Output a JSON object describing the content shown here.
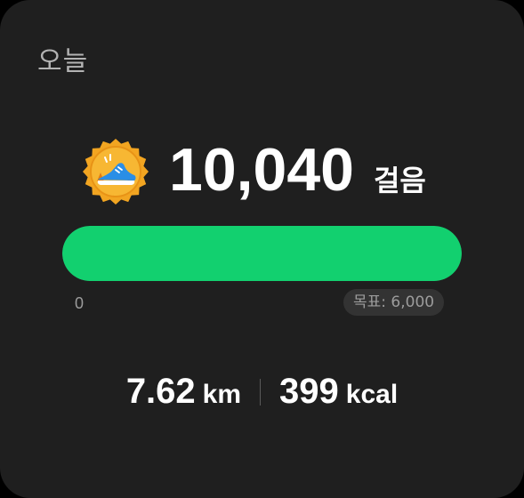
{
  "header": {
    "title": "오늘"
  },
  "steps": {
    "badge_icon": "running-shoe-badge-icon",
    "value": "10,040",
    "unit": "걸음"
  },
  "progress": {
    "min_label": "0",
    "goal_label": "목표: 6,000",
    "fraction": 1.0,
    "fill_color": "#12d06f"
  },
  "stats": {
    "distance_value": "7.62",
    "distance_unit": "km",
    "calories_value": "399",
    "calories_unit": "kcal"
  },
  "colors": {
    "card_background": "#1f1f1f",
    "badge_gold": "#f2a521",
    "shoe_blue": "#2a8ee6"
  }
}
